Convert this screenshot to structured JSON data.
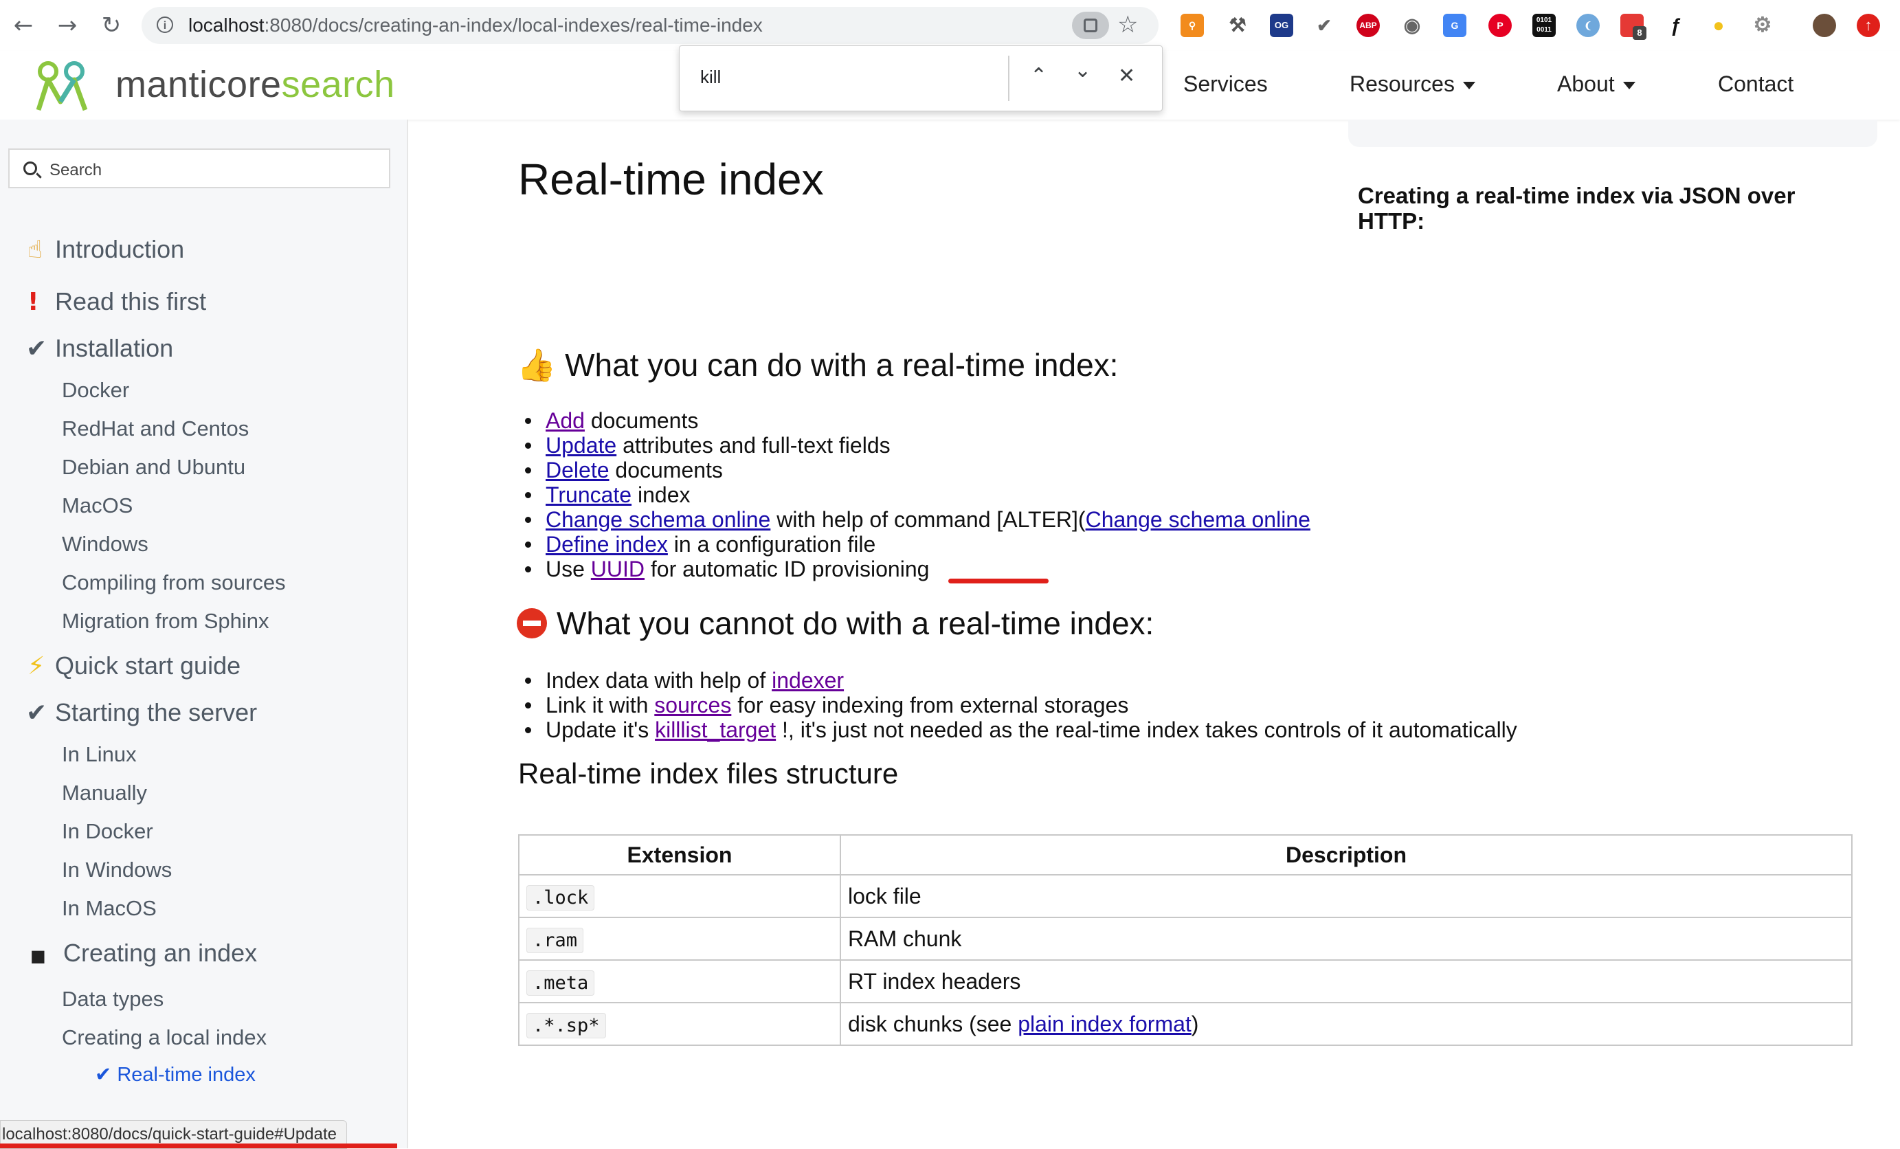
{
  "browser": {
    "url_host": "localhost",
    "url_path": ":8080/docs/creating-an-index/local-indexes/real-time-index",
    "back_icon": "arrow-left",
    "forward_icon": "arrow-right",
    "reload_icon": "reload",
    "extension_labels": [
      "OG",
      "ABP",
      "0101 0011",
      "8"
    ]
  },
  "find_bar": {
    "query": "kill"
  },
  "site": {
    "logo_part1": "manticore",
    "logo_part2": "search",
    "nav": {
      "services": "Services",
      "resources": "Resources",
      "about": "About",
      "contact": "Contact"
    },
    "brand_color": "#8cc63f"
  },
  "sidebar": {
    "search_placeholder": "Search",
    "items": [
      {
        "label": "Introduction",
        "icon": "☝"
      },
      {
        "label": "Read this first",
        "icon": "!"
      },
      {
        "label": "Installation",
        "icon": "✔"
      },
      {
        "label": "Docker"
      },
      {
        "label": "RedHat and Centos"
      },
      {
        "label": "Debian and Ubuntu"
      },
      {
        "label": "MacOS"
      },
      {
        "label": "Windows"
      },
      {
        "label": "Compiling from sources"
      },
      {
        "label": "Migration from Sphinx"
      },
      {
        "label": "Quick start guide",
        "icon": "⚡"
      },
      {
        "label": "Starting the server",
        "icon": "✔"
      },
      {
        "label": "In Linux"
      },
      {
        "label": "Manually"
      },
      {
        "label": "In Docker"
      },
      {
        "label": "In Windows"
      },
      {
        "label": "In MacOS"
      },
      {
        "label": "Creating an index",
        "icon": "■"
      },
      {
        "label": "Data types"
      },
      {
        "label": "Creating a local index"
      },
      {
        "label": "✔ Real-time index"
      }
    ]
  },
  "status_bar": {
    "url": "localhost:8080/docs/quick-start-guide#Update"
  },
  "content": {
    "title": "Real-time index",
    "toc_heading": "Creating a real-time index via JSON over HTTP:",
    "can_heading": "What you can do with a real-time index:",
    "can_items": [
      {
        "link": "Add",
        "text": " documents"
      },
      {
        "link": "Update",
        "text": " attributes and full-text fields"
      },
      {
        "link": "Delete",
        "text": " documents"
      },
      {
        "link": "Truncate",
        "text": " index"
      },
      {
        "link": "Change schema online",
        "text": " with help of command [ALTER](",
        "link2": "Change schema online"
      },
      {
        "link": "Define index",
        "text": " in a configuration file"
      },
      {
        "pre": "Use ",
        "link": "UUID",
        "text": " for automatic ID provisioning"
      }
    ],
    "cannot_heading": "What you cannot do with a real-time index:",
    "cannot_items": [
      {
        "pre": "Index data with help of ",
        "link": "indexer",
        "text": ""
      },
      {
        "pre": "Link it with ",
        "link": "sources",
        "text": " for easy indexing from external storages"
      },
      {
        "pre": "Update it's ",
        "link": "killlist_target",
        "text": " !, it's just not needed as the real-time index takes controls of it automatically"
      }
    ],
    "files_heading": "Real-time index files structure",
    "table": {
      "headers": [
        "Extension",
        "Description"
      ],
      "rows": [
        {
          "ext": ".lock",
          "desc": "lock file"
        },
        {
          "ext": ".ram",
          "desc": "RAM chunk"
        },
        {
          "ext": ".meta",
          "desc": "RT index headers"
        },
        {
          "ext": ".*.sp*",
          "desc_pre": "disk chunks (see ",
          "desc_link": "plain index format",
          "desc_post": ")"
        }
      ]
    },
    "link_color": "#1a0dab",
    "visited_link_color": "#660099",
    "highlight_color": "#e0201a"
  }
}
